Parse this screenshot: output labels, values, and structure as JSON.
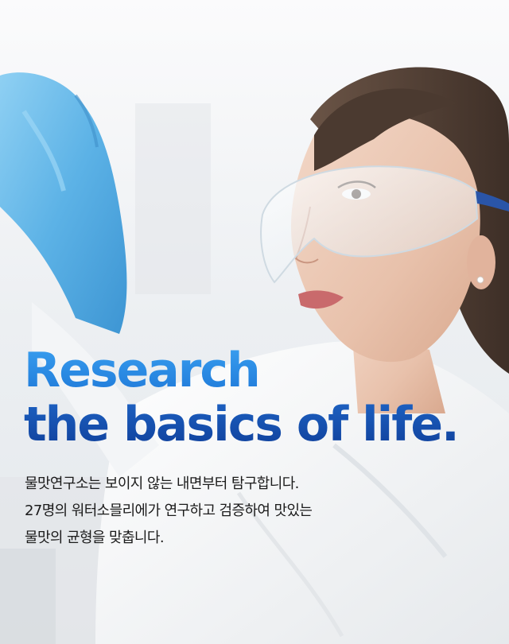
{
  "hero": {
    "headline_line1": "Research",
    "headline_line2": "the basics of life.",
    "description_lines": [
      "물맛연구소는 보이지 않는 내면부터 탐구합니다.",
      "27명의 워터소믈리에가 연구하고 검증하여 맛있는",
      "물맛의 균형을 맞춥니다."
    ]
  },
  "colors": {
    "headline_light_blue": "#2e8fe6",
    "headline_dark_blue": "#0f3f9a",
    "glove_blue": "#5fb3e6",
    "coat_white": "#f6f7f8",
    "body_text": "#1b1b1b"
  },
  "icons": {
    "photo": "researcher-with-safety-goggles-photo"
  }
}
